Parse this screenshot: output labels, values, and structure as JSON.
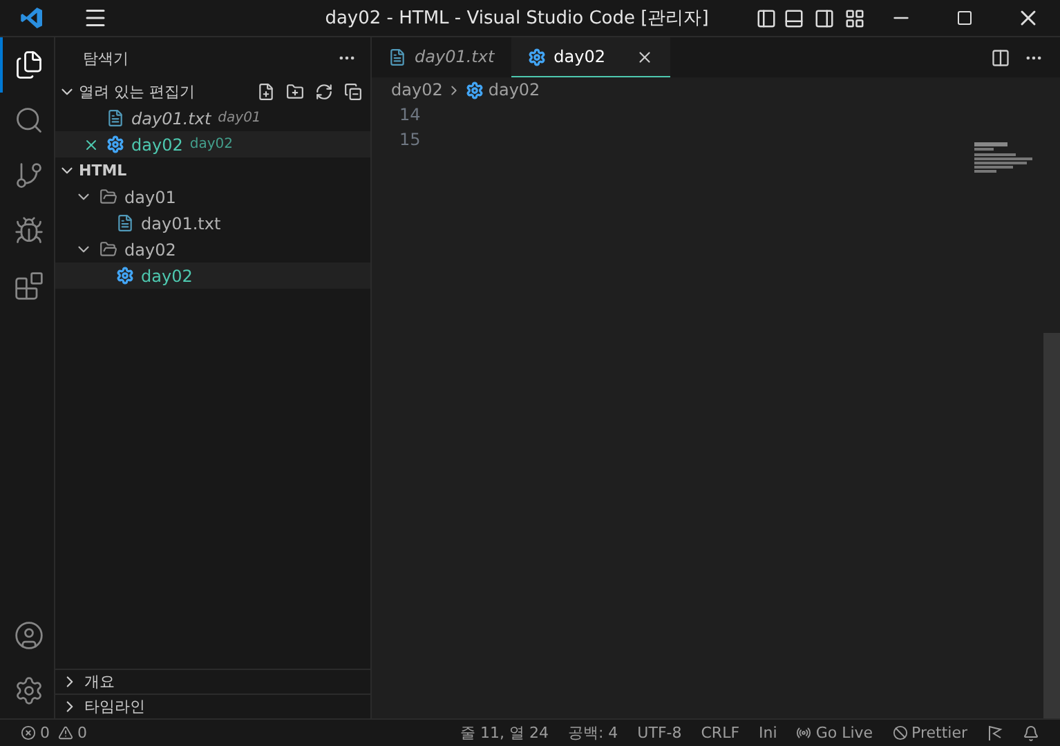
{
  "window": {
    "title": "day02 - HTML - Visual Studio Code [관리자]"
  },
  "activity_bar": [
    {
      "kind": "files",
      "selected": true
    },
    {
      "kind": "search",
      "selected": false
    },
    {
      "kind": "source",
      "selected": false
    },
    {
      "kind": "debug",
      "selected": false
    },
    {
      "kind": "extensions",
      "selected": false
    }
  ],
  "sidebar": {
    "title": "탐색기",
    "open_editors": {
      "label": "열려 있는 편집기",
      "expanded": true,
      "items": [
        {
          "name": "day01.txt",
          "folder": "day01",
          "kind": "text",
          "preview": true,
          "selected": false
        },
        {
          "name": "day02",
          "folder": "day02",
          "kind": "settings",
          "preview": false,
          "selected": true
        }
      ]
    },
    "folder": {
      "label": "HTML",
      "expanded": true,
      "children": [
        {
          "name": "day01",
          "kind": "folder",
          "expanded": true,
          "selected": false,
          "children": [
            {
              "name": "day01.txt",
              "kind": "text",
              "selected": false
            }
          ]
        },
        {
          "name": "day02",
          "kind": "folder",
          "expanded": true,
          "selected": false,
          "children": [
            {
              "name": "day02",
              "kind": "settings",
              "selected": true
            }
          ]
        }
      ]
    },
    "panels": [
      {
        "label": "개요",
        "expanded": false
      },
      {
        "label": "타임라인",
        "expanded": false
      }
    ]
  },
  "tabs": [
    {
      "label": "day01.txt",
      "kind": "text",
      "preview": true,
      "selected": false
    },
    {
      "label": "day02",
      "kind": "settings",
      "preview": false,
      "selected": true
    }
  ],
  "breadcrumb": [
    {
      "label": "day02",
      "kind": "folder"
    },
    {
      "label": "day02",
      "kind": "settings"
    }
  ],
  "line_numbers": [
    "14",
    "15"
  ],
  "status_bar": {
    "errors": "0",
    "warnings": "0",
    "items": [
      {
        "text": "줄 11, 열 24",
        "kind": "plain"
      },
      {
        "text": "공백: 4",
        "kind": "plain"
      },
      {
        "text": "UTF-8",
        "kind": "plain"
      },
      {
        "text": "CRLF",
        "kind": "plain"
      },
      {
        "text": "Ini",
        "kind": "plain"
      },
      {
        "text": "Go Live",
        "kind": "broadcast"
      },
      {
        "text": "Prettier",
        "kind": "off"
      }
    ]
  }
}
